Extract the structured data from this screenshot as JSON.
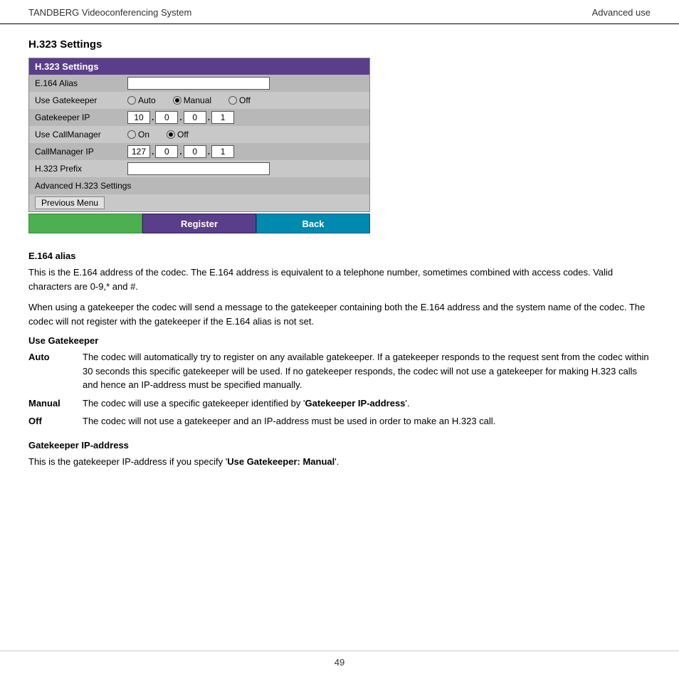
{
  "header": {
    "title": "TANDBERG Videoconferencing System",
    "section": "Advanced use"
  },
  "page_title": "H.323 Settings",
  "settings_panel": {
    "title": "H.323  Settings",
    "rows": [
      {
        "label": "E.164  Alias",
        "type": "label_only"
      },
      {
        "label": "Use  Gatekeeper",
        "type": "radio3",
        "options": [
          "Auto",
          "Manual",
          "Off"
        ],
        "selected": 1
      },
      {
        "label": "Gatekeeper IP",
        "type": "ip4",
        "values": [
          "10",
          "0",
          "0",
          "1"
        ]
      },
      {
        "label": "Use  CallManager",
        "type": "radio2",
        "options": [
          "On",
          "Off"
        ],
        "selected": 1
      },
      {
        "label": "CallManager IP",
        "type": "ip4",
        "values": [
          "127",
          "0",
          "0",
          "1"
        ]
      },
      {
        "label": "H.323  Prefix",
        "type": "textbox"
      },
      {
        "label": "Advanced H.323  Settings",
        "type": "label_only"
      },
      {
        "label": "Previous  Menu",
        "type": "prev_menu"
      }
    ]
  },
  "buttons": {
    "register": "Register",
    "back": "Back"
  },
  "doc": {
    "section1": {
      "heading": "E.164 alias",
      "para1": "This is the E.164 address of the codec. The E.164 address is equivalent to a telephone number, sometimes combined with access codes. Valid characters are 0-9,* and #.",
      "para2": "When using a gatekeeper the codec will send a message to the gatekeeper containing both the E.164 address and the system name of the codec. The codec will not register with the gatekeeper if the E.164 alias is not set."
    },
    "section2": {
      "heading": "Use Gatekeeper",
      "terms": [
        {
          "term": "Auto",
          "desc": "The codec will automatically try to register on any available gatekeeper. If a gatekeeper responds to the request sent from the codec within 30 seconds this specific gatekeeper will be used. If no gatekeeper responds, the codec will not use a gatekeeper for making H.323 calls and hence an IP-address must be specified manually."
        },
        {
          "term": "Manual",
          "desc_prefix": "The codec will use a specific gatekeeper identified by '",
          "desc_bold": "Gatekeeper IP-address",
          "desc_suffix": "'."
        },
        {
          "term": "Off",
          "desc": "The codec will not use a gatekeeper and an IP-address must be used in order to make an H.323 call."
        }
      ]
    },
    "section3": {
      "heading": "Gatekeeper IP-address",
      "para": "This is the gatekeeper IP-address if you specify 'Use Gatekeeper: Manual'.",
      "para_bold": "Use Gatekeeper: Manual"
    }
  },
  "footer": {
    "page_number": "49"
  }
}
